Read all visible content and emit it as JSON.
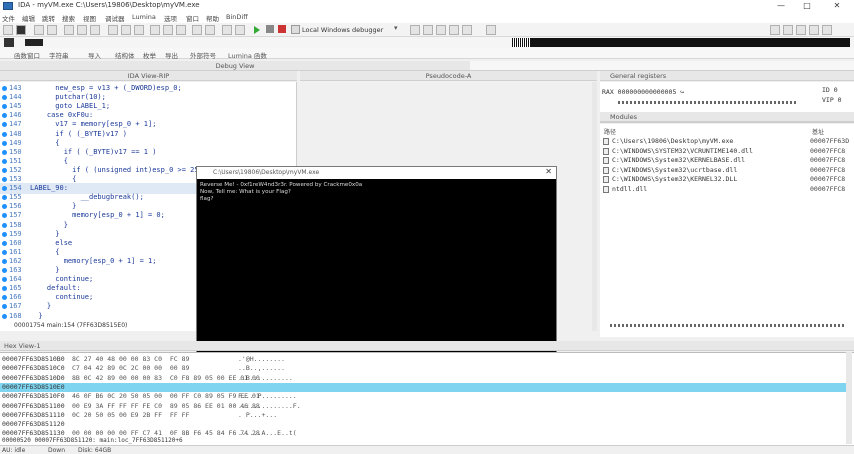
{
  "window": {
    "title": "IDA - myVM.exe C:\\Users\\19806\\Desktop\\myVM.exe",
    "controls": [
      "—",
      "□",
      "✕"
    ]
  },
  "menu": [
    "文件",
    "编辑",
    "跳转",
    "搜索",
    "视图",
    "调试器",
    "Lumina",
    "选项",
    "窗口",
    "帮助",
    "BinDiff"
  ],
  "toolbar": {
    "debugger_select": "Local Windows debugger"
  },
  "tabs": [
    "函数窗口",
    "字符串",
    "导入",
    "结构体",
    "枚举",
    "导出",
    "外部符号",
    "Lumina 函数"
  ],
  "debug_view": {
    "title": "Debug View"
  },
  "ida_view": {
    "title": "IDA View-RIP",
    "lines": [
      {
        "n": "143",
        "t": "      new_esp = v13 + (_DWORD)esp_0;"
      },
      {
        "n": "144",
        "t": "      putchar(10);"
      },
      {
        "n": "145",
        "t": "      goto LABEL_1;"
      },
      {
        "n": "146",
        "t": "    case 0xF0u:"
      },
      {
        "n": "147",
        "t": "      v17 = memory[esp_0 + 1];"
      },
      {
        "n": "148",
        "t": "      if ( (_BYTE)v17 )"
      },
      {
        "n": "149",
        "t": "      {"
      },
      {
        "n": "150",
        "t": "        if ( (_BYTE)v17 == 1 )"
      },
      {
        "n": "151",
        "t": "        {"
      },
      {
        "n": "152",
        "t": "          if ( (unsigned int)esp_0 >= 256"
      },
      {
        "n": "153",
        "t": "          {"
      },
      {
        "n": "154",
        "t": "LABEL_90:"
      },
      {
        "n": "155",
        "t": "            __debugbreak();"
      },
      {
        "n": "156",
        "t": "          }"
      },
      {
        "n": "157",
        "t": "          memory[esp_0 + 1] = 0;"
      },
      {
        "n": "158",
        "t": "        }"
      },
      {
        "n": "159",
        "t": "      }"
      },
      {
        "n": "160",
        "t": "      else"
      },
      {
        "n": "161",
        "t": "      {"
      },
      {
        "n": "162",
        "t": "        memory[esp_0 + 1] = 1;"
      },
      {
        "n": "163",
        "t": "      }"
      },
      {
        "n": "164",
        "t": "      continue;"
      },
      {
        "n": "165",
        "t": "    default:"
      },
      {
        "n": "166",
        "t": "      continue;"
      },
      {
        "n": "167",
        "t": "    }"
      },
      {
        "n": "168",
        "t": "  }"
      }
    ],
    "footer": "00001754 main:154 (7FF63D8515E0)"
  },
  "pseudocode": {
    "title": "Pseudocode-A"
  },
  "registers": {
    "title": "General registers",
    "rax": "RAX 000000000000005 ↪",
    "flags": [
      "ID 0",
      "VIP 0"
    ]
  },
  "modules": {
    "title": "Modules",
    "col_path": "路径",
    "col_base": "基址",
    "rows": [
      {
        "path": "C:\\Users\\19806\\Desktop\\myVM.exe",
        "base": "00007FF63D"
      },
      {
        "path": "C:\\WINDOWS\\SYSTEM32\\VCRUNTIME140.dll",
        "base": "00007FFC8"
      },
      {
        "path": "C:\\WINDOWS\\System32\\KERNELBASE.dll",
        "base": "00007FFC8"
      },
      {
        "path": "C:\\WINDOWS\\System32\\ucrtbase.dll",
        "base": "00007FFC8"
      },
      {
        "path": "C:\\WINDOWS\\System32\\KERNEL32.DLL",
        "base": "00007FFC8"
      },
      {
        "path": "ntdll.dll",
        "base": "00007FFC8"
      }
    ]
  },
  "console": {
    "title": "C:\\Users\\19806\\Desktop\\myVM.exe",
    "lines": [
      "Reverse Me! - 0xf1reW4nd3r3r. Powered by Crackme0x0a",
      "Now, Tell me: What is your Flag?",
      "flag?"
    ]
  },
  "hex_view": {
    "title": "Hex View-1",
    "rows": [
      {
        "a": "00007FF63D8510B0",
        "b": "8C 27 40 48 00 00 83 C0  FC 89",
        "c": ".'@H........"
      },
      {
        "a": "00007FF63D8510C0",
        "b": "C7 04 42 89 0C 2C 00 00  00 89",
        "c": "..B..,......"
      },
      {
        "a": "00007FF63D8510D0",
        "b": "8B 0C 42 89 00 00 00 83  C0 F8 89 05 00 EE 01 00",
        "c": "..B..........."
      },
      {
        "a": "00007FF63D8510E0",
        "b": "",
        "c": ""
      },
      {
        "a": "00007FF63D8510F0",
        "b": "46 0F B6 0C 20 50 05 00  00 FF C0 89 05 F9 EE 01",
        "c": "F... P........."
      },
      {
        "a": "00007FF63D851100",
        "b": "00 E9 3A FF FF FF FE C0  89 05 86 EE 01 00 46 88",
        "c": "..:...........F."
      },
      {
        "a": "00007FF63D851110",
        "b": "0C 20 50 05 00 E9 2B FF  FF FF",
        "c": ". P...+..."
      },
      {
        "a": "00007FF63D851120",
        "b": "",
        "c": ""
      },
      {
        "a": "00007FF63D851130",
        "b": "00 00 00 00 00 FF C7 41  0F 8B F6 45 84 F6 74 28",
        "c": "......A...E..t("
      }
    ],
    "footer": "00000520 00007FF63D851120: main:loc_7FF63D851120+6"
  },
  "status": {
    "au": "AU:  idle",
    "dir": "Down",
    "disk": "Disk: 64GB"
  }
}
